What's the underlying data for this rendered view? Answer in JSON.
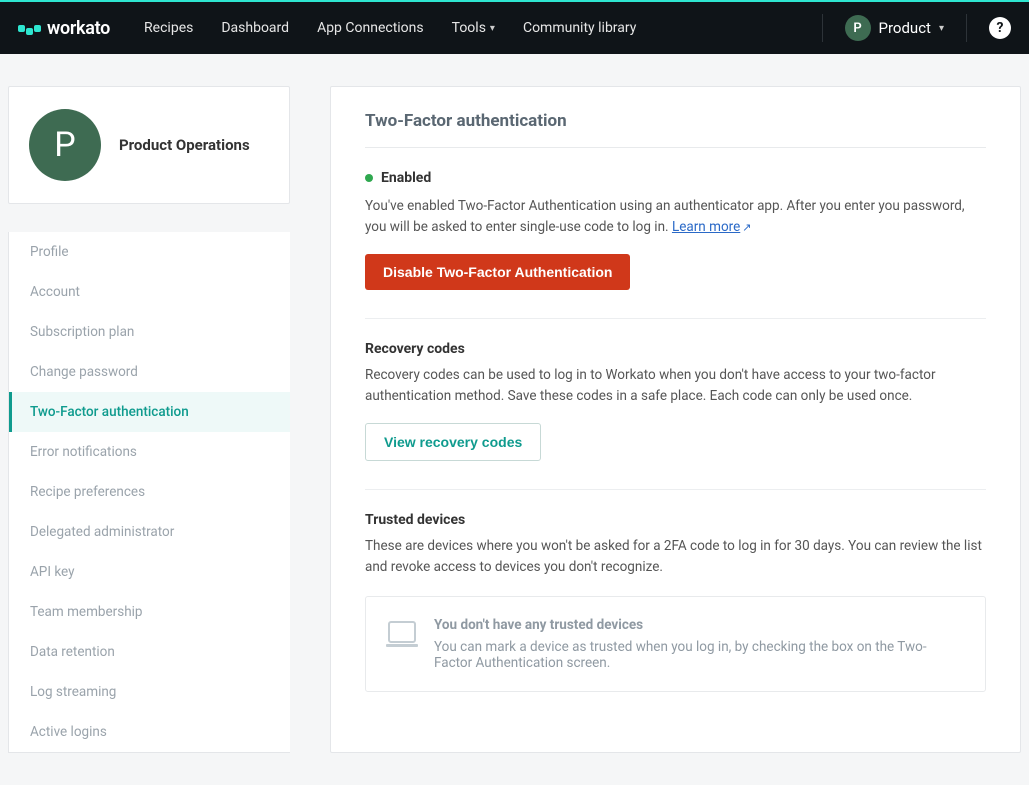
{
  "brand": "workato",
  "nav": {
    "items": [
      "Recipes",
      "Dashboard",
      "App Connections",
      "Tools",
      "Community library"
    ]
  },
  "user": {
    "initial": "P",
    "name": "Product"
  },
  "profile": {
    "initial": "P",
    "title": "Product Operations"
  },
  "sidebar": {
    "items": [
      "Profile",
      "Account",
      "Subscription plan",
      "Change password",
      "Two-Factor authentication",
      "Error notifications",
      "Recipe preferences",
      "Delegated administrator",
      "API key",
      "Team membership",
      "Data retention",
      "Log streaming",
      "Active logins"
    ],
    "activeIndex": 4
  },
  "main": {
    "title": "Two-Factor authentication",
    "status": {
      "label": "Enabled",
      "description": "You've enabled Two-Factor Authentication using an authenticator app. After you enter you password, you will be asked to enter single-use code to log in. ",
      "learnMore": "Learn more",
      "disableBtn": "Disable Two-Factor Authentication"
    },
    "recovery": {
      "heading": "Recovery codes",
      "text": "Recovery codes can be used to log in to Workato when you don't have access to your two-factor authentication method. Save these codes in a safe place. Each code can only be used once.",
      "button": "View recovery codes"
    },
    "trusted": {
      "heading": "Trusted devices",
      "text": "These are devices where you won't be asked for a 2FA code to log in for 30 days. You can review the list and revoke access to devices you don't recognize.",
      "emptyTitle": "You don't have any trusted devices",
      "emptyText": "You can mark a device as trusted when you log in, by checking the box on the Two-Factor Authentication screen."
    }
  }
}
